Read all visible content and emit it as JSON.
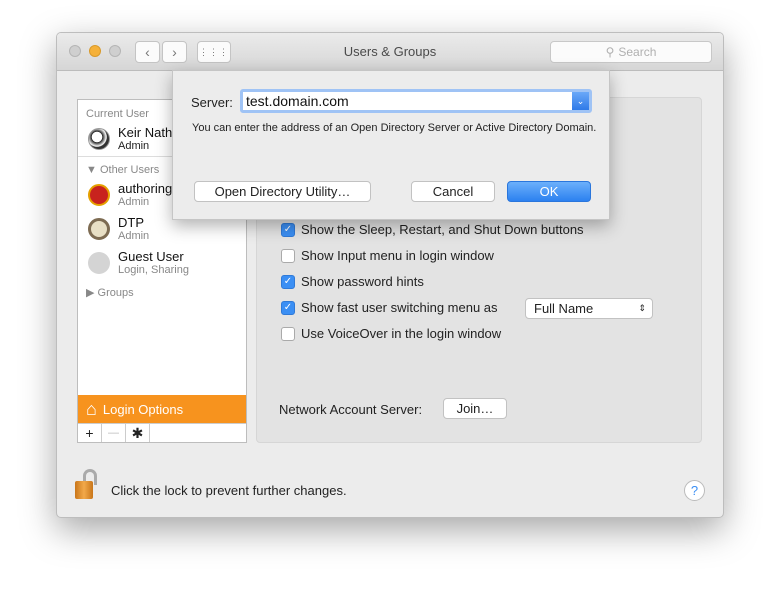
{
  "window": {
    "title": "Users & Groups",
    "search_placeholder": "Search"
  },
  "sidebar": {
    "current_user_header": "Current User",
    "current_user": {
      "name": "Keir Nath",
      "role": "Admin"
    },
    "other_users_header": "Other Users",
    "users": [
      {
        "name": "authoring",
        "role": "Admin"
      },
      {
        "name": "DTP",
        "role": "Admin"
      },
      {
        "name": "Guest User",
        "role": "Login, Sharing"
      }
    ],
    "groups_header": "Groups",
    "login_options": "Login Options",
    "add": "+",
    "remove": "—"
  },
  "options": [
    {
      "label": "Show the Sleep, Restart, and Shut Down buttons",
      "checked": true
    },
    {
      "label": "Show Input menu in login window",
      "checked": false
    },
    {
      "label": "Show password hints",
      "checked": true
    },
    {
      "label": "Show fast user switching menu as",
      "checked": true
    },
    {
      "label": "Use VoiceOver in the login window",
      "checked": false
    }
  ],
  "fast_switch_select": "Full Name",
  "network": {
    "label": "Network Account Server:",
    "join": "Join…"
  },
  "lock_text": "Click the lock to prevent further changes.",
  "help": "?",
  "sheet": {
    "server_label": "Server:",
    "server_value": "test.domain.com",
    "hint": "You can enter the address of an Open Directory Server or Active Directory Domain.",
    "odu": "Open Directory Utility…",
    "cancel": "Cancel",
    "ok": "OK"
  },
  "colors": {
    "accent": "#3b8ff4",
    "selection": "#f7931e"
  }
}
